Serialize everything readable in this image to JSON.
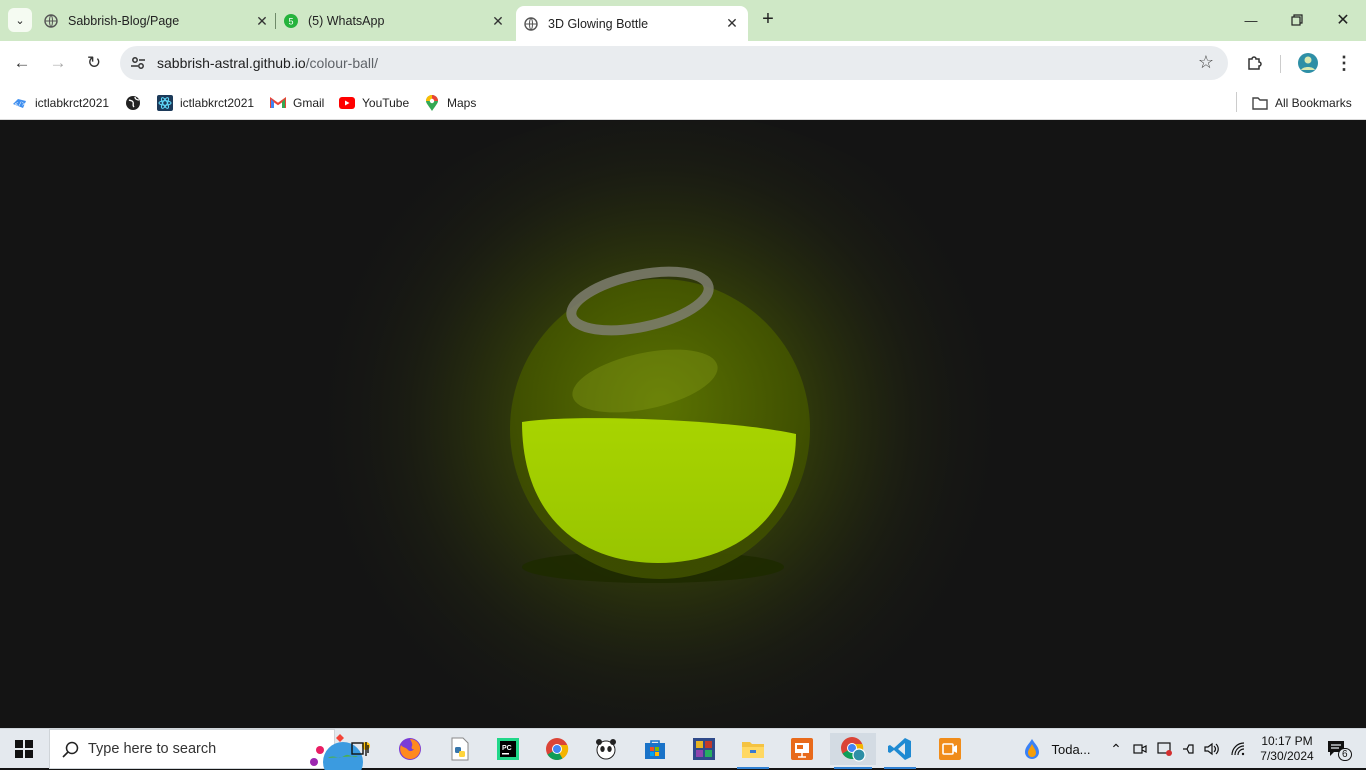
{
  "browser": {
    "tabs": [
      {
        "title": "Sabbrish-Blog/Page",
        "active": false
      },
      {
        "title": "(5) WhatsApp",
        "active": false,
        "badge": "5"
      },
      {
        "title": "3D Glowing Bottle",
        "active": true
      }
    ],
    "address": {
      "host": "sabbrish-astral.github.io",
      "path": "/colour-ball/"
    },
    "bookmarks": [
      {
        "label": "ictlabkrct2021",
        "icon": "code-icon"
      },
      {
        "label": "",
        "icon": "globe-icon"
      },
      {
        "label": "ictlabkrct2021",
        "icon": "react-icon"
      },
      {
        "label": "Gmail",
        "icon": "gmail-icon"
      },
      {
        "label": "YouTube",
        "icon": "youtube-icon"
      },
      {
        "label": "Maps",
        "icon": "maps-icon"
      }
    ],
    "all_bookmarks": "All Bookmarks"
  },
  "taskbar": {
    "search_placeholder": "Type here to search",
    "weather": "Toda...",
    "time": "10:17 PM",
    "date": "7/30/2024",
    "notifications": "6"
  },
  "colors": {
    "page_bg": "#141414",
    "liquid": "#9cc700",
    "glow": "#7f9f00",
    "tab_bar": "#cfe8c6"
  }
}
